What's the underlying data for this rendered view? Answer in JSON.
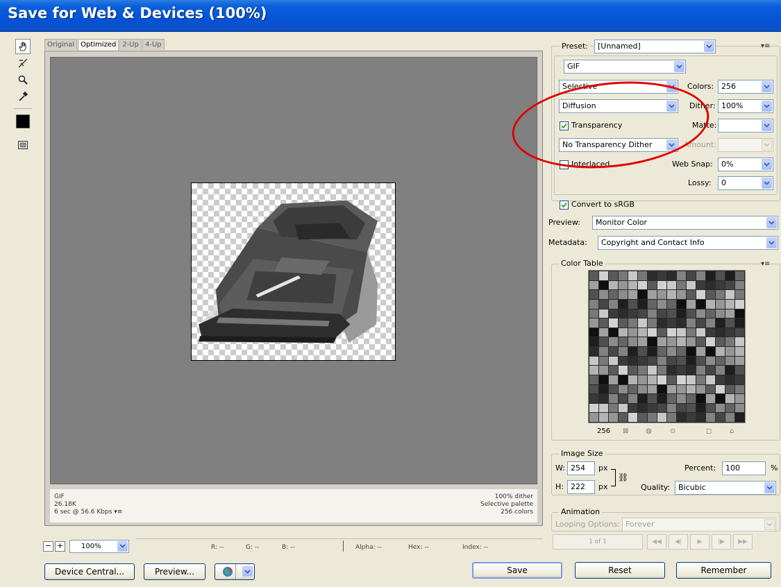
{
  "window": {
    "title": "Save for Web & Devices (100%)"
  },
  "tabs": [
    "Original",
    "Optimized",
    "2-Up",
    "4-Up"
  ],
  "info": {
    "format": "GIF",
    "size": "26.18K",
    "time": "6 sec @ 56.6 Kbps",
    "dither": "100% dither",
    "palette": "Selective palette",
    "colors": "256 colors"
  },
  "status": {
    "zoom": "100%",
    "r": "R: --",
    "g": "G: --",
    "b": "B: --",
    "alpha": "Alpha: --",
    "hex": "Hex: --",
    "index": "Index: --"
  },
  "buttons": {
    "device_central": "Device Central...",
    "preview": "Preview...",
    "save": "Save",
    "reset": "Reset",
    "remember": "Remember"
  },
  "settings": {
    "preset_label": "Preset:",
    "preset": "[Unnamed]",
    "format": "GIF",
    "reduction": "Selective",
    "colors_label": "Colors:",
    "colors": "256",
    "dither_algo": "Diffusion",
    "dither_label": "Dither:",
    "dither": "100%",
    "transparency_label": "Transparency",
    "transparency_checked": true,
    "matte_label": "Matte:",
    "matte": "",
    "transparency_dither": "No Transparency Dither",
    "amount_label": "Amount:",
    "amount": "",
    "interlaced_label": "Interlaced",
    "interlaced_checked": false,
    "websnap_label": "Web Snap:",
    "websnap": "0%",
    "lossy_label": "Lossy:",
    "lossy": "0",
    "srgb_label": "Convert to sRGB",
    "srgb_checked": true,
    "preview_label": "Preview:",
    "preview": "Monitor Color",
    "metadata_label": "Metadata:",
    "metadata": "Copyright and Contact Info"
  },
  "color_table": {
    "title": "Color Table",
    "count": "256",
    "colors": [
      "#5a5a5a",
      "#8c8c8c",
      "#3a3a3a",
      "#b4b4b4",
      "#1e1e1e",
      "#787878",
      "#a0a0a0",
      "#464646",
      "#d2d2d2",
      "#646464",
      "#2c2c2c",
      "#969696",
      "#505050",
      "#c8c8c8",
      "#0f0f0f",
      "#828282"
    ]
  },
  "image_size": {
    "title": "Image Size",
    "w_label": "W:",
    "w": "254",
    "h_label": "H:",
    "h": "222",
    "unit": "px",
    "percent_label": "Percent:",
    "percent": "100",
    "percent_unit": "%",
    "quality_label": "Quality:",
    "quality": "Bicubic"
  },
  "animation": {
    "title": "Animation",
    "looping_label": "Looping Options:",
    "looping": "Forever",
    "frame": "1 of 1"
  },
  "icons": [
    "hand-icon",
    "slice-select-icon",
    "zoom-icon",
    "eyedropper-icon",
    "color-swatch-icon",
    "toggle-slices-icon",
    "browser-icon",
    "menu-icon"
  ]
}
